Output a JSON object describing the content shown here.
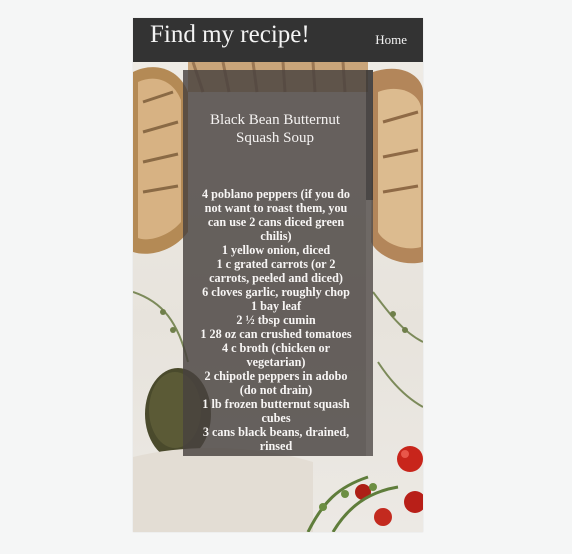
{
  "navbar": {
    "brand": "Find my recipe!",
    "home_link": "Home"
  },
  "recipe": {
    "title": "Black Bean Butternut Squash Soup",
    "ingredients": [
      "4 poblano peppers (if you do not want to roast them, you can use 2 cans diced green chilis)",
      "1 yellow onion, diced",
      "1 c grated carrots (or 2 carrots, peeled and diced)",
      "6 cloves garlic, roughly chop",
      "1 bay leaf",
      "2 ½ tbsp cumin",
      "1 28 oz can crushed tomatoes",
      "4 c broth (chicken or vegetarian)",
      "2 chipotle peppers in adobo (do not drain)",
      "1 lb frozen butternut squash cubes",
      "3 cans black beans, drained, rinsed"
    ]
  }
}
